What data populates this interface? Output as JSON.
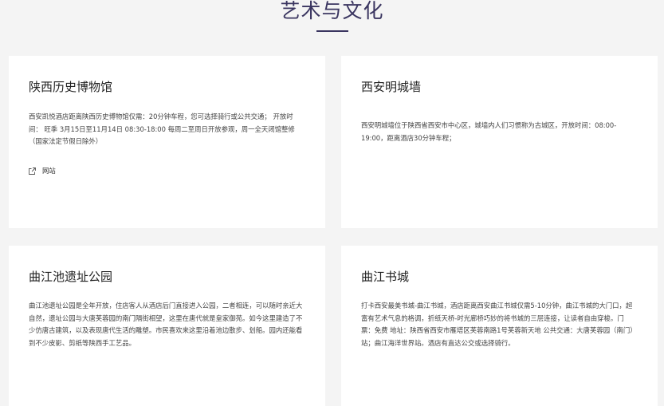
{
  "section": {
    "title": "艺术与文化"
  },
  "cards": [
    {
      "title": "陕西历史博物馆",
      "description": "西安凯悦酒店距离陕西历史博物馆仅需：20分钟车程，您可选择骑行或公共交通； 开放时间： 旺季 3月15日至11月14日 08:30-18:00 每周二至周日开放参观，周一全天闭馆整修 （国家法定节假日除外）",
      "link_label": "网站"
    },
    {
      "title": "西安明城墙",
      "description": "西安明城墙位于陕西省西安市中心区，城墙内人们习惯称为古城区，开放时间：08:00-19:00，距离酒店30分钟车程；"
    },
    {
      "title": "曲江池遗址公园",
      "description": "曲江池遗址公园是全年开放，住店客人从酒店后门直接进入公园，二者相连，可以随时亲近大自然，遗址公园与大唐芙蓉园的南门隔街相望，这里在唐代就是皇家御苑。如今这里建造了不少仿唐古建筑，以及表现唐代生活的雕塑。市民喜欢来这里沿着池边散步、划船。园内还能看到不少皮影、剪纸等陕西手工艺品。"
    },
    {
      "title": "曲江书城",
      "description": "打卡西安最美书城-曲江书城，酒店距离西安曲江书城仅需5-10分钟，曲江书城的大门口，超富有艺术气息的格调，折纸天桥-时光廊桥巧妙的将书城的三层连接，让读者自由穿梭。门票：免费 地址：陕西省西安市雁塔区芙蓉南路1号芙蓉新天地 公共交通：大唐芙蓉园（南门）站；曲江海洋世界站。酒店有直达公交或选择骑行。"
    }
  ],
  "icons": {
    "external_link": "external-link-icon"
  },
  "colors": {
    "title": "#3a3560",
    "background": "#f4f4f4",
    "card": "#ffffff"
  }
}
